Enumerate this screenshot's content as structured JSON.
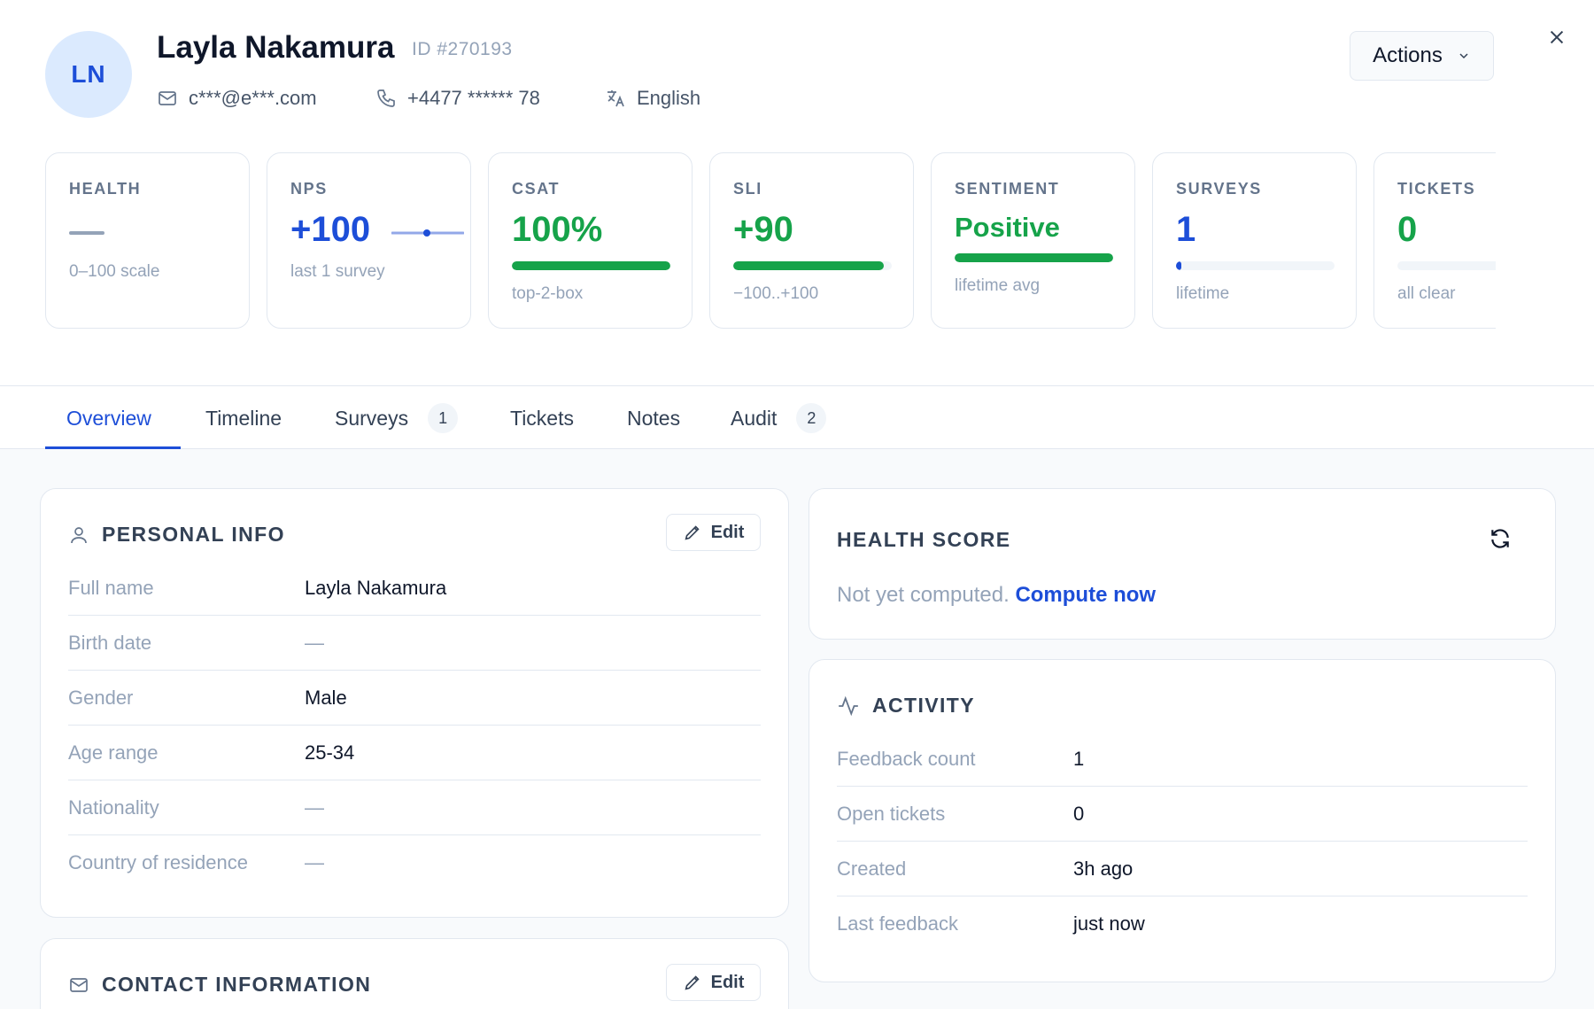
{
  "profile": {
    "initials": "LN",
    "name": "Layla Nakamura",
    "id_label": "ID #270193",
    "email": "c***@e***.com",
    "phone": "+4477 ****** 78",
    "language": "English"
  },
  "header": {
    "actions_label": "Actions"
  },
  "metrics": [
    {
      "label": "HEALTH",
      "value": "",
      "sub": "0–100 scale"
    },
    {
      "label": "NPS",
      "value": "+100",
      "sub": "last 1 survey",
      "color": "#1d4ed8"
    },
    {
      "label": "CSAT",
      "value": "100%",
      "sub": "top-2-box",
      "color": "#16a34a",
      "fill": 1.0
    },
    {
      "label": "SLI",
      "value": "+90",
      "sub": "−100..+100",
      "color": "#16a34a",
      "fill": 0.95
    },
    {
      "label": "SENTIMENT",
      "value": "Positive",
      "sub": "lifetime avg",
      "color": "#16a34a",
      "fill": 1.0
    },
    {
      "label": "SURVEYS",
      "value": "1",
      "sub": "lifetime",
      "color": "#1d4ed8",
      "fill": 0.03
    },
    {
      "label": "TICKETS",
      "value": "0",
      "sub": "all clear",
      "color": "#16a34a",
      "fill": 0
    }
  ],
  "tabs": [
    {
      "label": "Overview",
      "active": true
    },
    {
      "label": "Timeline"
    },
    {
      "label": "Surveys",
      "badge": "1"
    },
    {
      "label": "Tickets"
    },
    {
      "label": "Notes"
    },
    {
      "label": "Audit",
      "badge": "2"
    }
  ],
  "personal_info": {
    "title": "PERSONAL INFO",
    "edit_label": "Edit",
    "rows": [
      {
        "key": "Full name",
        "value": "Layla Nakamura"
      },
      {
        "key": "Birth date",
        "value": "—"
      },
      {
        "key": "Gender",
        "value": "Male"
      },
      {
        "key": "Age range",
        "value": "25-34"
      },
      {
        "key": "Nationality",
        "value": "—"
      },
      {
        "key": "Country of residence",
        "value": "—"
      }
    ]
  },
  "contact_info": {
    "title": "CONTACT INFORMATION",
    "edit_label": "Edit"
  },
  "health_score": {
    "title": "HEALTH SCORE",
    "message": "Not yet computed.",
    "action_label": "Compute now"
  },
  "activity": {
    "title": "ACTIVITY",
    "rows": [
      {
        "key": "Feedback count",
        "value": "1"
      },
      {
        "key": "Open tickets",
        "value": "0"
      },
      {
        "key": "Created",
        "value": "3h ago"
      },
      {
        "key": "Last feedback",
        "value": "just now"
      }
    ]
  },
  "colors": {
    "accent": "#1d4ed8",
    "positive": "#16a34a",
    "muted": "#94a3b8"
  }
}
